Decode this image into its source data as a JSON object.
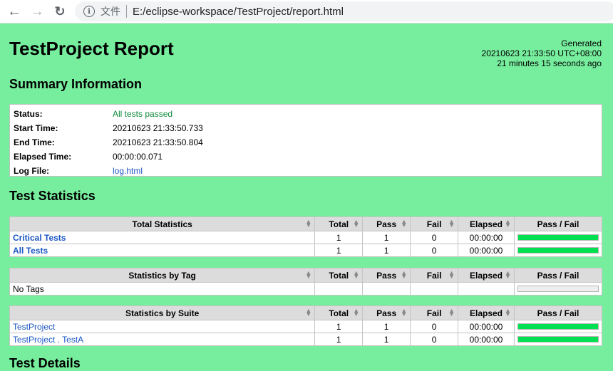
{
  "browser": {
    "scheme_label": "文件",
    "url": "E:/eclipse-workspace/TestProject/report.html",
    "back_icon": "arrow-left",
    "forward_icon": "arrow-right",
    "reload_icon": "reload",
    "info_icon": "info-circle"
  },
  "header": {
    "title": "TestProject Report",
    "generated_label": "Generated",
    "generated_time": "20210623 21:33:50 UTC+08:00",
    "generated_ago": "21 minutes 15 seconds ago"
  },
  "summary": {
    "heading": "Summary Information",
    "rows": [
      {
        "label": "Status:",
        "value": "All tests passed"
      },
      {
        "label": "Start Time:",
        "value": "20210623 21:33:50.733"
      },
      {
        "label": "End Time:",
        "value": "20210623 21:33:50.804"
      },
      {
        "label": "Elapsed Time:",
        "value": "00:00:00.071"
      },
      {
        "label": "Log File:",
        "value": "log.html"
      }
    ]
  },
  "statistics": {
    "heading": "Test Statistics",
    "columns": [
      "Total",
      "Pass",
      "Fail",
      "Elapsed",
      "Pass / Fail"
    ],
    "total": {
      "title": "Total Statistics",
      "rows": [
        {
          "name": "Critical Tests",
          "total": "1",
          "pass": "1",
          "fail": "0",
          "elapsed": "00:00:00",
          "pass_ratio": 1.0
        },
        {
          "name": "All Tests",
          "total": "1",
          "pass": "1",
          "fail": "0",
          "elapsed": "00:00:00",
          "pass_ratio": 1.0
        }
      ]
    },
    "tag": {
      "title": "Statistics by Tag",
      "empty_label": "No Tags"
    },
    "suite": {
      "title": "Statistics by Suite",
      "rows": [
        {
          "name": "TestProject",
          "total": "1",
          "pass": "1",
          "fail": "0",
          "elapsed": "00:00:00",
          "pass_ratio": 1.0
        },
        {
          "name": "TestProject . TestA",
          "total": "1",
          "pass": "1",
          "fail": "0",
          "elapsed": "00:00:00",
          "pass_ratio": 1.0
        }
      ]
    }
  },
  "details": {
    "heading": "Test Details"
  },
  "colors": {
    "page_bg": "#77ee9e",
    "pass_bar": "#00e050",
    "pass_text": "#0f8a3c",
    "link": "#1a56c4"
  }
}
